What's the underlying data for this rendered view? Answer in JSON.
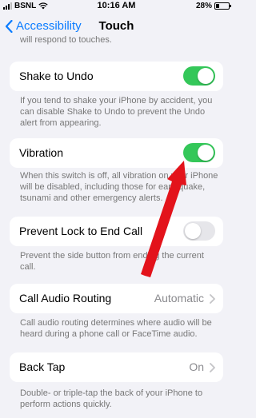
{
  "status_bar": {
    "carrier": "BSNL",
    "time": "10:16 AM",
    "battery": "28%",
    "battery_level": 0.28
  },
  "nav": {
    "back_label": "Accessibility",
    "title": "Touch"
  },
  "prev_footer_text": "will respond to touches.",
  "settings": {
    "shake_to_undo": {
      "label": "Shake to Undo",
      "on": true,
      "footer": "If you tend to shake your iPhone by accident, you can disable Shake to Undo to prevent the Undo alert from appearing."
    },
    "vibration": {
      "label": "Vibration",
      "on": true,
      "footer": "When this switch is off, all vibration on your iPhone will be disabled, including those for earthquake, tsunami and other emergency alerts."
    },
    "prevent_lock": {
      "label": "Prevent Lock to End Call",
      "on": false,
      "footer": "Prevent the side button from ending the current call."
    },
    "call_audio_routing": {
      "label": "Call Audio Routing",
      "value": "Automatic",
      "footer": "Call audio routing determines where audio will be heard during a phone call or FaceTime audio."
    },
    "back_tap": {
      "label": "Back Tap",
      "value": "On",
      "footer": "Double- or triple-tap the back of your iPhone to perform actions quickly."
    }
  },
  "colors": {
    "accent": "#0a7cff",
    "toggle_on": "#34c759",
    "annotation_arrow": "#e3131b"
  },
  "icons": [
    "back-chevron-icon",
    "chevron-right-icon",
    "signal-icon",
    "wifi-icon",
    "battery-icon"
  ]
}
